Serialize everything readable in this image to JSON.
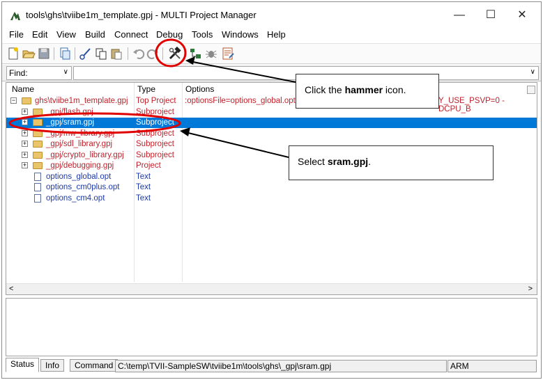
{
  "window": {
    "title": "tools\\ghs\\tviibe1m_template.gpj - MULTI Project Manager",
    "minimize": "—",
    "maximize": "☐",
    "close": "✕"
  },
  "menu": [
    "File",
    "Edit",
    "View",
    "Build",
    "Connect",
    "Debug",
    "Tools",
    "Windows",
    "Help"
  ],
  "toolbar": {
    "icons": [
      "new-project-icon",
      "open-icon",
      "save-icon",
      "copy-file-icon",
      "cut-icon",
      "copy-icon",
      "paste-icon",
      "undo-icon",
      "redo-icon",
      "hammer-build-icon",
      "rebuild-icon",
      "debug-icon",
      "edit-options-icon"
    ]
  },
  "find": {
    "label": "Find:",
    "value": ""
  },
  "tree": {
    "columns": {
      "name": "Name",
      "type": "Type",
      "options": "Options"
    },
    "rows": [
      {
        "name": "ghs\\tviibe1m_template.gpj",
        "type": "Top Project",
        "options": ":optionsFile=options_global.opt",
        "options_right": "Y_USE_PSVP=0 -DCPU_B",
        "kind": "folder",
        "expander": "⊟",
        "color": "red",
        "selected": false
      },
      {
        "name": "_gpj/flash.gpj",
        "type": "Subproject",
        "options": "",
        "kind": "folder",
        "expander": "⊞",
        "color": "red",
        "selected": false
      },
      {
        "name": "_gpj/sram.gpj",
        "type": "Subproject",
        "options": "",
        "kind": "folder",
        "expander": "⊞",
        "color": "red",
        "selected": true
      },
      {
        "name": "_gpj/mw_library.gpj",
        "type": "Subproject",
        "options": "",
        "kind": "folder",
        "expander": "⊞",
        "color": "red",
        "selected": false
      },
      {
        "name": "_gpj/sdl_library.gpj",
        "type": "Subproject",
        "options": "",
        "kind": "folder",
        "expander": "⊞",
        "color": "red",
        "selected": false
      },
      {
        "name": "_gpj/crypto_library.gpj",
        "type": "Subproject",
        "options": "",
        "kind": "folder",
        "expander": "⊞",
        "color": "red",
        "selected": false
      },
      {
        "name": "_gpj/debugging.gpj",
        "type": "Project",
        "options": "",
        "kind": "folder",
        "expander": "⊞",
        "color": "red",
        "selected": false
      },
      {
        "name": "options_global.opt",
        "type": "Text",
        "options": "",
        "kind": "doc",
        "expander": "",
        "color": "blue",
        "selected": false
      },
      {
        "name": "options_cm0plus.opt",
        "type": "Text",
        "options": "",
        "kind": "doc",
        "expander": "",
        "color": "blue",
        "selected": false
      },
      {
        "name": "options_cm4.opt",
        "type": "Text",
        "options": "",
        "kind": "doc",
        "expander": "",
        "color": "blue",
        "selected": false
      }
    ],
    "scroll_left": "<",
    "scroll_right": ">"
  },
  "bottom": {
    "tabs": [
      "Status",
      "Info",
      "Command"
    ],
    "active_tab": "Status",
    "path": "C:\\temp\\TVII-SampleSW\\tviibe1m\\tools\\ghs\\_gpj\\sram.gpj",
    "arch": "ARM"
  },
  "annotations": {
    "callout1": {
      "pre": "Click the ",
      "bold": "hammer",
      "post": " icon."
    },
    "callout2": {
      "pre": "Select ",
      "bold": "sram.gpj",
      "post": "."
    },
    "highlight_color": "#e00000"
  }
}
